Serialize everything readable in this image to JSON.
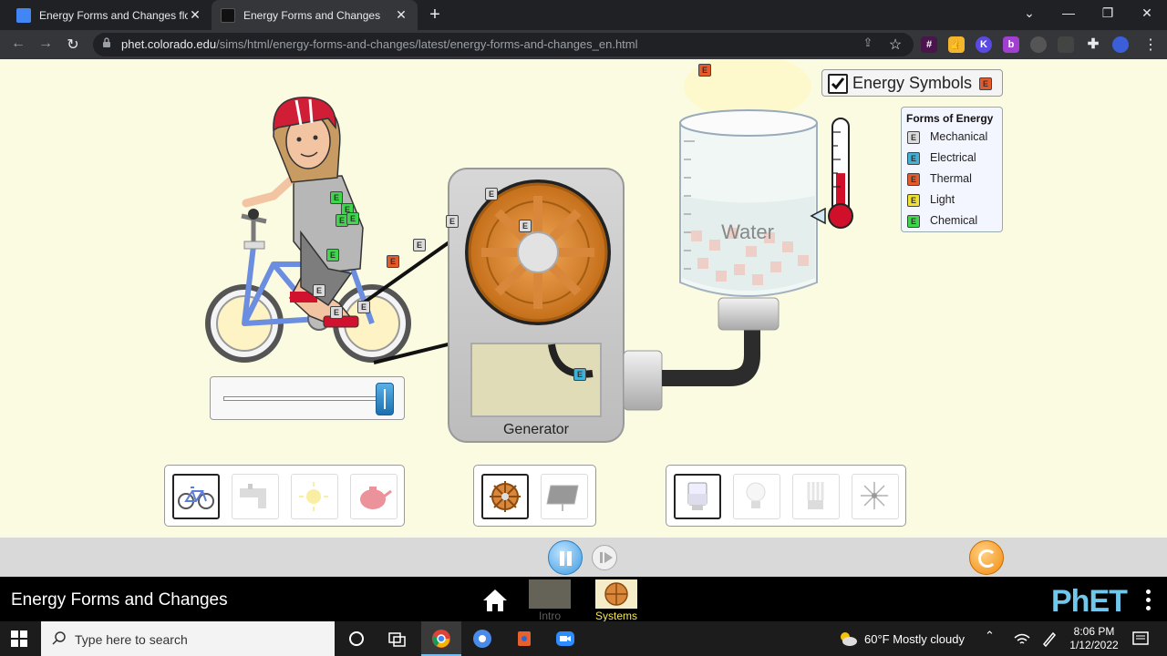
{
  "browser": {
    "tabs": [
      {
        "title": "Energy Forms and Changes flow",
        "active": false
      },
      {
        "title": "Energy Forms and Changes",
        "active": true
      }
    ],
    "url_host": "phet.colorado.edu",
    "url_path": "/sims/html/energy-forms-and-changes/latest/energy-forms-and-changes_en.html"
  },
  "sim": {
    "energy_symbols_label": "Energy Symbols",
    "energy_symbols_checked": true,
    "chip_letter": "E",
    "legend": {
      "title": "Forms of Energy",
      "items": [
        {
          "label": "Mechanical",
          "color": "#dcdcdc"
        },
        {
          "label": "Electrical",
          "color": "#3fb1d6"
        },
        {
          "label": "Thermal",
          "color": "#e55a2b"
        },
        {
          "label": "Light",
          "color": "#efe22f"
        },
        {
          "label": "Chemical",
          "color": "#3fd54c"
        }
      ]
    },
    "generator_label": "Generator",
    "water_label": "Water",
    "cyclist_slider_value": 0.95,
    "thermometer_level": 0.42,
    "sources": [
      "bicycle-icon",
      "faucet-icon",
      "sun-icon",
      "teapot-icon"
    ],
    "converters": [
      "generator-wheel-icon",
      "solar-panel-icon"
    ],
    "users": [
      "beaker-icon",
      "incandescent-bulb-icon",
      "fluorescent-bulb-icon",
      "fan-icon"
    ],
    "selected_source": 0,
    "selected_converter": 0,
    "selected_user": 0
  },
  "nav": {
    "sim_title": "Energy Forms and Changes",
    "screens": [
      {
        "label": "Intro",
        "active": false
      },
      {
        "label": "Systems",
        "active": true
      }
    ],
    "logo": "PhET"
  },
  "taskbar": {
    "search_placeholder": "Type here to search",
    "weather": "60°F  Mostly cloudy",
    "time": "8:06 PM",
    "date": "1/12/2022"
  }
}
